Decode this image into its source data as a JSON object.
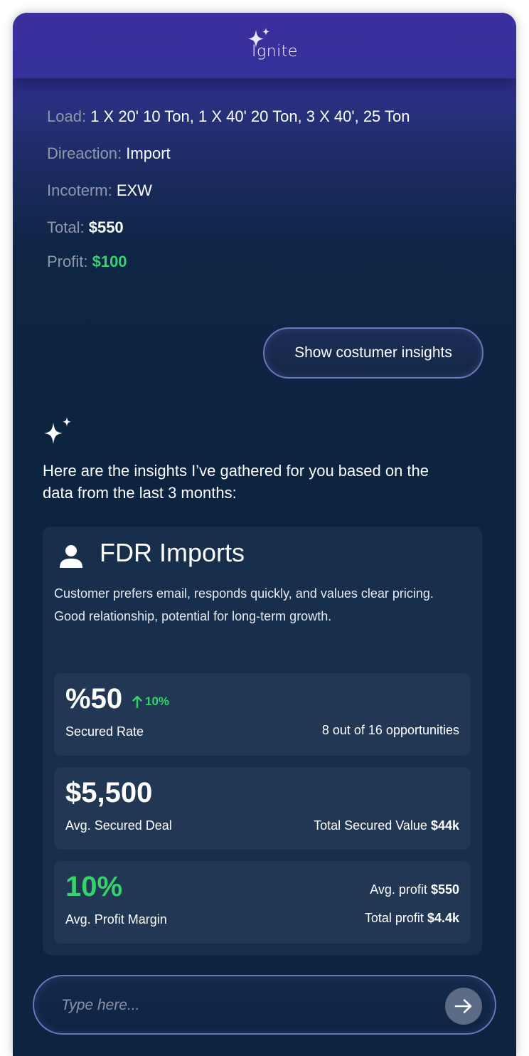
{
  "app": {
    "name": "Ignite"
  },
  "details": {
    "load_label": "Load:",
    "load_value": "1 X 20' 10 Ton, 1 X 40' 20 Ton, 3 X 40', 25 Ton",
    "direction_label": "Direaction:",
    "direction_value": "Import",
    "incoterm_label": "Incoterm:",
    "incoterm_value": "EXW",
    "total_label": "Total:",
    "total_value": "$550",
    "profit_label": "Profit:",
    "profit_value": "$100"
  },
  "insights_button": {
    "label": "Show costumer insights"
  },
  "assistant": {
    "intro": "Here are the insights I’ve gathered for you based on the data from the last 3 months:"
  },
  "customer": {
    "name": "FDR Imports",
    "description": "Customer prefers email, responds quickly, and values clear pricing. Good relationship, potential for long-term growth."
  },
  "stats": {
    "secured_rate": {
      "value": "%50",
      "trend": "10%",
      "label": "Secured Rate",
      "detail": "8 out of 16 opportunities"
    },
    "avg_deal": {
      "value": "$5,500",
      "label": "Avg. Secured Deal",
      "total_label": "Total Secured Value",
      "total_value": "$44k"
    },
    "profit_margin": {
      "value": "10%",
      "label": "Avg. Profit Margin",
      "avg_profit_label": "Avg. profit",
      "avg_profit_value": "$550",
      "total_profit_label": "Total profit",
      "total_profit_value": "$4.4k"
    }
  },
  "chat": {
    "placeholder": "Type here..."
  },
  "colors": {
    "accent_green": "#34d36b",
    "header_purple": "#3b2f9e",
    "background_navy": "#0c2440",
    "card_bg": "#172f4c",
    "stat_bg": "#223754"
  },
  "icons": [
    "sparkle-icon",
    "person-icon",
    "arrow-up-icon",
    "arrow-right-icon"
  ]
}
